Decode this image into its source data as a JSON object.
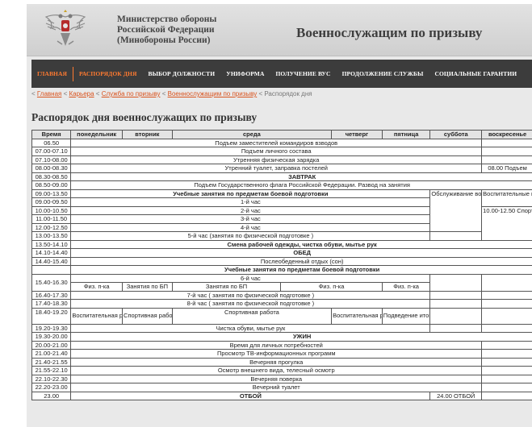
{
  "header": {
    "org_line1": "Министерство обороны",
    "org_line2": "Российской Федерации",
    "org_line3": "(Минобороны России)",
    "site_title": "Военнослужащим по призыву",
    "emblem": "double-headed-eagle-emblem"
  },
  "nav": {
    "items": [
      "ГЛАВНАЯ",
      "РАСПОРЯДОК ДНЯ",
      "ВЫБОР ДОЛЖНОСТИ",
      "УНИФОРМА",
      "ПОЛУЧЕНИЕ ВУС",
      "ПРОДОЛЖЕНИЕ СЛУЖБЫ",
      "СОЦИАЛЬНЫЕ ГАРАНТИИ"
    ]
  },
  "breadcrumb": {
    "prefix": "< ",
    "links": [
      "Главная",
      "Карьера",
      "Служба по призыву",
      "Военнослужащим по призыву"
    ],
    "separator": " < ",
    "current": "Распорядок дня"
  },
  "page_title": "Распорядок дня военнослужащих по призыву",
  "table": {
    "headers": [
      "Время",
      "понедельник",
      "вторник",
      "среда",
      "четверг",
      "пятница",
      "суббота",
      "воскресенье"
    ],
    "rows": {
      "r1": {
        "time": "06.50",
        "text": "Подъем заместителей командиров взводов"
      },
      "r2": {
        "time": "07.00-07.10",
        "text": "Подъем личного состава"
      },
      "r3": {
        "time": "07.10-08.00",
        "text": "Утренняя физическая зарядка"
      },
      "r4": {
        "time": "08.00-08.30",
        "text": "Утренний туалет, заправка постелей",
        "sun": "08.00 Подъем"
      },
      "r5": {
        "time": "08.30-08.50",
        "text": "ЗАВТРАК"
      },
      "r6": {
        "time": "08.50-09.00",
        "text": "Подъем Государственного флага Российской Федерации. Развод на занятия"
      },
      "r7": {
        "time": "09.00-13.50",
        "text": "Учебные занятия по предметам боевой подготовки"
      },
      "r8": {
        "time": "09.00-09.50",
        "text": "1-й час"
      },
      "r9": {
        "time": "10.00-10.50",
        "text": "2-й час"
      },
      "r10": {
        "time": "11.00-11.50",
        "text": "3-й час"
      },
      "r11": {
        "time": "12.00-12.50",
        "text": "4-й час"
      },
      "r12": {
        "time": "13.00-13.50",
        "text": "5-й час (занятия по физической подготовке )"
      },
      "r13": {
        "time": "13.50-14.10",
        "text": "Смена рабочей одежды, чистка обуви, мытье рук"
      },
      "r14": {
        "time": "14.10-14.40",
        "text": "ОБЕД"
      },
      "r15": {
        "time": "14.40-15.40",
        "text": "Послеобеденный отдых (сон)"
      },
      "r16": {
        "time": "",
        "text": "Учебные занятия по предметам боевой подготовки"
      },
      "r17": {
        "time": "15.40-16.30",
        "text": "6-й час"
      },
      "r18": {
        "mon": "Физ. п-ка",
        "tue": "Занятия по БП",
        "wed": "Занятия по БП",
        "thu": "Физ. п-ка",
        "fri": "Физ. п-ка"
      },
      "r19": {
        "time": "16.40-17.30",
        "text": "7-й час ( занятия по физической подготовке )"
      },
      "r20": {
        "time": "17.40-18.30",
        "text": "8-й час ( занятия по физической подготовке )"
      },
      "r21": {
        "time": "18.40-19.20",
        "mon": "Воспитательная работа",
        "tue": "Спортивная работа",
        "wed": "Спортивная работа",
        "thu": "Воспитательная работа",
        "fri": "Подведение итогов"
      },
      "r22": {
        "time": "19.20-19.30",
        "text": "Чистка обуви, мытье рук"
      },
      "r23": {
        "time": "19.30-20.00",
        "text": "УЖИН"
      },
      "r24": {
        "time": "20.00-21.00",
        "text": "Время для личных потребностей"
      },
      "r25": {
        "time": "21.00-21.40",
        "text": "Просмотр ТВ-информационных программ"
      },
      "r26": {
        "time": "21.40-21.55",
        "text": "Вечерняя прогулка"
      },
      "r27": {
        "time": "21.55-22.10",
        "text": "Осмотр внешнего вида, телесный осмотр"
      },
      "r28": {
        "time": "22.10-22.30",
        "text": "Вечерняя поверка"
      },
      "r29": {
        "time": "22.20-23.00",
        "text": "Вечерний туалет"
      },
      "r30": {
        "time": "23.00",
        "text": "ОТБОЙ",
        "sat": "24.00 ОТБОЙ"
      }
    },
    "sat_block": "Обслуживание вооружения и военной техники",
    "sun_block1": "Воспитательные мероприятия",
    "sun_block2": "10.00-12.50 Спортивно-массовая работа"
  }
}
